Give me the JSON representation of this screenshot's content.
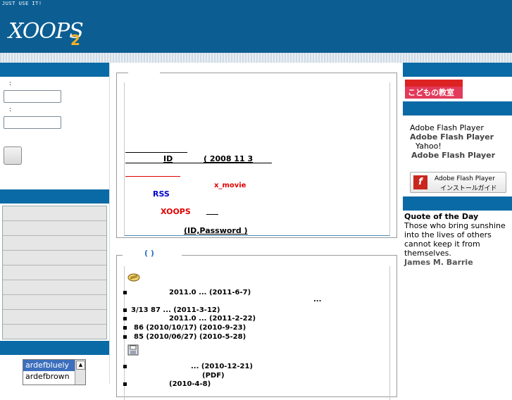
{
  "header": {
    "tagline": "JUST USE IT!",
    "logo_text": "XOOPS",
    "logo_version": "2"
  },
  "left": {
    "login_label_1": ":",
    "login_label_2": ":",
    "themes": [
      "ardefbluely",
      "ardefbrown"
    ]
  },
  "center": {
    "info_id": "ID",
    "info_date": "(   2008  11   3",
    "info_xmovie": "x_movie",
    "info_rss": "RSS",
    "info_xoops": "XOOPS",
    "info_idpw": "(ID,Password   )",
    "news_title": "(      )",
    "news_ellipsis": "...",
    "news": [
      {
        "text": "2011.0 ... (2011-6-7)"
      },
      {
        "text": "3/13          87       ... (2011-3-12)"
      },
      {
        "text": "2011.0 ... (2011-2-22)"
      },
      {
        "text": "86          (2010/10/17) (2010-9-23)"
      },
      {
        "text": "85          (2010/06/27) (2010-5-28)"
      }
    ],
    "dl": [
      {
        "text": "... (2010-12-21)"
      },
      {
        "text": "(PDF)"
      },
      {
        "text": "(2010-4-8)"
      }
    ]
  },
  "right": {
    "banner_text": "こどもの教室",
    "flash_text_1": "Adobe Flash Player",
    "flash_text_2": "Adobe Flash Player",
    "flash_text_3": "Yahoo!",
    "flash_text_4": "Adobe Flash Player",
    "flash_btn_1": "Adobe Flash Player",
    "flash_btn_2": "インストールガイド",
    "quote_title": "Quote of the Day",
    "quote_text": "Those who bring sunshine into the lives of others cannot keep it from themselves.",
    "quote_author": "James M. Barrie"
  },
  "colors": {
    "header_blue": "#0c5e92",
    "block_bar_blue": "#0a6aa6",
    "link_red": "#e00000",
    "link_blue": "#0000cc"
  }
}
